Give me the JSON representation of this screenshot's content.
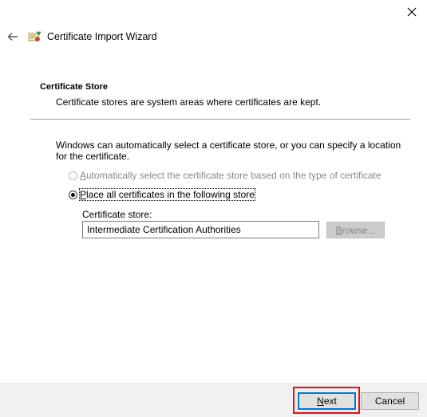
{
  "window": {
    "title": "Certificate Import Wizard"
  },
  "section": {
    "heading": "Certificate Store",
    "description": "Certificate stores are system areas where certificates are kept."
  },
  "intro": "Windows can automatically select a certificate store, or you can specify a location for the certificate.",
  "options": {
    "auto": {
      "label_first": "A",
      "label_rest": "utomatically select the certificate store based on the type of certificate",
      "checked": false,
      "enabled": false
    },
    "manual": {
      "label_first": "P",
      "label_rest": "lace all certificates in the following store",
      "checked": true,
      "enabled": true
    }
  },
  "store": {
    "label": "Certificate store:",
    "value": "Intermediate Certification Authorities",
    "browse_first": "B",
    "browse_rest": "rowse..."
  },
  "footer": {
    "next_first": "N",
    "next_rest": "ext",
    "cancel": "Cancel"
  },
  "icons": {
    "close": "close-icon",
    "back": "back-arrow-icon",
    "wizard": "certificate-icon"
  },
  "colors": {
    "highlight": "#e3101b",
    "focus": "#0078d7",
    "footer_bg": "#f0f0f0"
  }
}
